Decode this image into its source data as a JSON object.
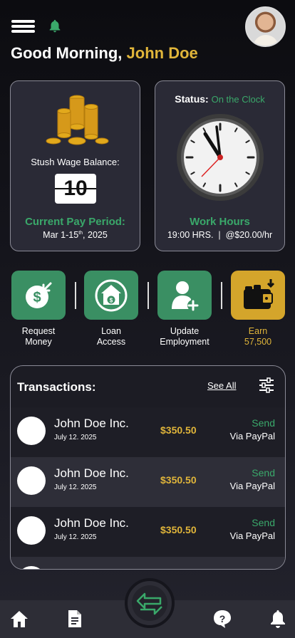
{
  "header": {
    "menu_icon": "hamburger-menu-icon",
    "bell_icon": "bell-icon",
    "greeting_prefix": "Good Morning,",
    "user_name": "John Doe"
  },
  "wage_card": {
    "label": "Stush Wage Balance:",
    "balance": "10",
    "period_title": "Current Pay Period:",
    "period_start": "Mar 1-15",
    "period_sup": "th",
    "period_year": ", 2025"
  },
  "status_card": {
    "status_label": "Status:",
    "status_value": "On the Clock",
    "hours_title": "Work Hours",
    "hours_detail": "19:00 HRS.  |  @$20.00/hr"
  },
  "actions": [
    {
      "line1": "Request",
      "line2": "Money",
      "icon": "request-money-icon"
    },
    {
      "line1": "Loan",
      "line2": "Access",
      "icon": "loan-access-icon"
    },
    {
      "line1": "Update",
      "line2": "Employment",
      "icon": "add-user-icon"
    },
    {
      "line1": "Earn",
      "line2": "57,500",
      "icon": "wallet-icon"
    }
  ],
  "transactions": {
    "title": "Transactions:",
    "see_all": "See All",
    "rows": [
      {
        "company": "John Doe Inc.",
        "date": "July 12. 2025",
        "amount": "$350.50",
        "kind": "Send",
        "via": "Via PayPal"
      },
      {
        "company": "John Doe Inc.",
        "date": "July 12. 2025",
        "amount": "$350.50",
        "kind": "Send",
        "via": "Via PayPal"
      },
      {
        "company": "John Doe Inc.",
        "date": "July 12. 2025",
        "amount": "$350.50",
        "kind": "Send",
        "via": "Via PayPal"
      }
    ]
  },
  "bottom_nav": [
    "home-icon",
    "document-icon",
    "help-icon",
    "bell-icon"
  ],
  "colors": {
    "accent_green": "#3aa86a",
    "accent_gold": "#e0b53a",
    "tile_green": "#3a8f63"
  }
}
